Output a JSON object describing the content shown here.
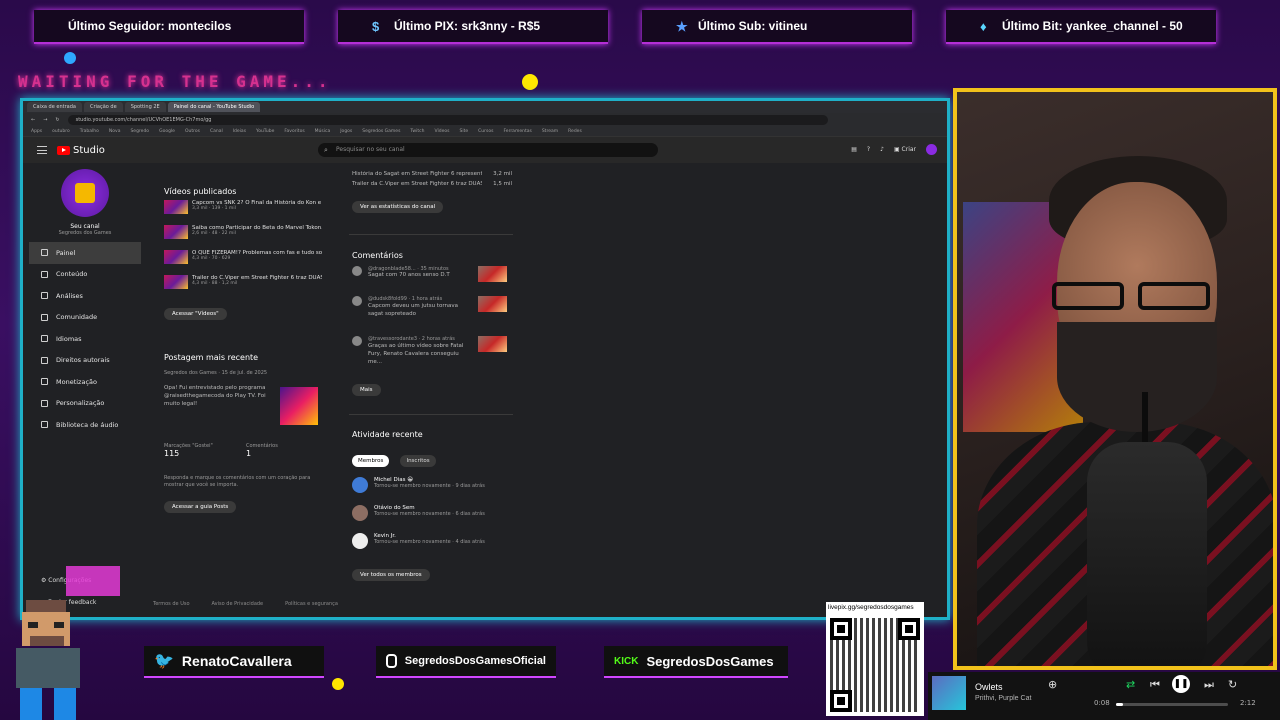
{
  "overlay": {
    "alerts": [
      {
        "label": "Último Seguidor: montecilos",
        "icon": "none"
      },
      {
        "label": "Último PIX: srk3nny - R$5",
        "icon": "dollar-icon"
      },
      {
        "label": "Último Sub: vitineu",
        "icon": "star-icon"
      },
      {
        "label": "Último Bit: yankee_channel - 50",
        "icon": "diamond-icon"
      }
    ],
    "waiting_text": "WAITING FOR THE GAME...",
    "socials": [
      {
        "label": "RenatoCavallera",
        "icon": "twitter-icon"
      },
      {
        "label": "SegredosDosGamesOficial",
        "icon": "instagram-icon"
      },
      {
        "label": "SegredosDosGames",
        "icon": "kick-icon",
        "badge": "KICK"
      }
    ],
    "qr_url": "livepix.gg/segredosdosgames",
    "colors": {
      "alert_border": "#b42fd6",
      "browser_border": "#1fb0c8",
      "cam_border": "#f2c21b"
    }
  },
  "browser": {
    "tabs": [
      "Caixa de entrada",
      "Criação de",
      "Spotting 2E",
      "Painel do canal - YouTube Studio"
    ],
    "url": "studio.youtube.com/channel/UCVhOE1EMG-Ch7mo/gg",
    "bookmarks": [
      "Apps",
      "outubro",
      "Trabalho",
      "Nova",
      "Segredo",
      "Google",
      "Outros",
      "Canal",
      "Ideias",
      "YouTube",
      "Favoritos",
      "Música",
      "Jogos",
      "Segredos Games",
      "Twitch",
      "Vídeos",
      "Site",
      "Cursos",
      "Ferramentas",
      "Stream",
      "Redes"
    ]
  },
  "studio": {
    "logo": "Studio",
    "search_placeholder": "Pesquisar no seu canal",
    "create_label": "Criar",
    "channel": {
      "title": "Seu canal",
      "name": "Segredos dos Games"
    },
    "nav": [
      "Painel",
      "Conteúdo",
      "Análises",
      "Comunidade",
      "Idiomas",
      "Direitos autorais",
      "Monetização",
      "Personalização",
      "Biblioteca de áudio"
    ],
    "bottom_nav": [
      "Configurações",
      "Enviar feedback"
    ],
    "published": {
      "title": "Vídeos publicados",
      "videos": [
        {
          "title": "Capcom vs SNK 2? O Final da História do Kon e ...",
          "meta": "3,3 mil · 139 · 1 mil"
        },
        {
          "title": "Saiba como Participar do Beta do Marvel Tokon...",
          "meta": "2,6 mil · 48 · 22 mil"
        },
        {
          "title": "O QUE FIZERAM!? Problemas com fas e tudo sobre...",
          "meta": "4,3 mil · 70 · 629"
        },
        {
          "title": "Trailer do C.Viper em Street Fighter 6 traz DUAS...",
          "meta": "4,3 mil · 88 · 1,2 mil"
        }
      ],
      "button": "Acessar \"Vídeos\""
    },
    "recent_post": {
      "title": "Postagem mais recente",
      "author": "Segredos dos Games",
      "date": "15 de jul. de 2025",
      "text": "Opa! Fui entrevistado pelo programa @raisedthegamecoda do Play TV. Foi muito legal!",
      "likes_label": "Marcações \"Gostei\"",
      "likes": "115",
      "comments_label": "Comentários",
      "comments": "1",
      "hint": "Responda e marque os comentários com um coração para mostrar que você se importa.",
      "button": "Acessar a guia Posts"
    },
    "top_videos": [
      {
        "title": "História do Sagat em Street Fighter 6 representa o...",
        "views": "3,2 mil"
      },
      {
        "title": "Trailer da C.Viper em Street Fighter 6 traz DUAS G...",
        "views": "1,5 mil"
      }
    ],
    "stats_button": "Ver as estatísticas do canal",
    "comments": {
      "title": "Comentários",
      "items": [
        {
          "user": "@dragonblade58...",
          "time": "35 minutos",
          "text": "Sagat com 70 anos senso D.T"
        },
        {
          "user": "@dudsk8fold99",
          "time": "1 hora atrás",
          "text": "Capcom deveu um jutsu tornava sagat sopreteado"
        },
        {
          "user": "@travessorodante3",
          "time": "2 horas atrás",
          "text": "Graças ao último vídeo sobre Fatal Fury, Renato Cavalera conseguiu me..."
        }
      ],
      "more": "Mais"
    },
    "activity": {
      "title": "Atividade recente",
      "tabs": [
        "Membros",
        "Inscritos"
      ],
      "members": [
        {
          "name": "Michel Dias 😀",
          "desc": "Tornou-se membro novamente · 9 dias atrás"
        },
        {
          "name": "Otávio do Sem",
          "desc": "Tornou-se membro novamente · 6 dias atrás"
        },
        {
          "name": "Kevin Jr.",
          "desc": "Tornou-se membro novamente · 4 dias atrás"
        }
      ],
      "button": "Ver todos os membros"
    },
    "footer": [
      "Termos de Uso",
      "Aviso de Privacidade",
      "Políticas e segurança"
    ]
  },
  "player": {
    "song": "Owlets",
    "artist": "Prithvi, Purple Cat",
    "elapsed": "0:08",
    "duration": "2:12",
    "progress": 0.06
  }
}
